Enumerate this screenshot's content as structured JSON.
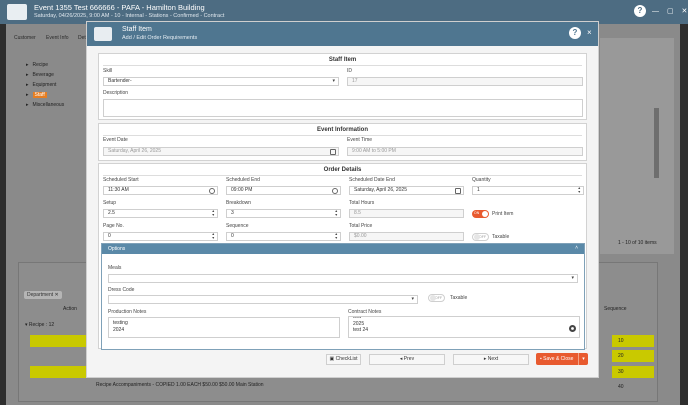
{
  "app": {
    "title": "Event 1355 Test 666666 - PAFA - Hamilton Building",
    "subtitle": "Saturday, 04/26/2025, 9:00 AM - 10 - Internal - Stations - Confirmed - Contract",
    "help": "?",
    "header_icons": "— ▢ ✕"
  },
  "background": {
    "tabs": [
      "Customer",
      "Event Info",
      "Det"
    ],
    "tree": [
      {
        "label": "Recipe",
        "highlight": false
      },
      {
        "label": "Beverage",
        "highlight": false
      },
      {
        "label": "Equipment",
        "highlight": false
      },
      {
        "label": "Staff",
        "highlight": true
      },
      {
        "label": "Miscellaneous",
        "highlight": false
      }
    ],
    "items_count": "1 - 10 of 10 items",
    "chip": "Department ✕",
    "action_header": "Action",
    "recipe_group": "▾ Recipe : 12",
    "sequence_header": "Sequence",
    "row_values": [
      "10",
      "20",
      "30",
      "40"
    ],
    "last_row": "Recipe     Accompaniments - COPIED          1.00    EACH    $50.00    $50.00            Main Station"
  },
  "modal": {
    "title": "Staff Item",
    "subtitle": "Add / Edit Order Requirements",
    "help": "?",
    "close": "×",
    "staff_item": {
      "section_title": "Staff Item",
      "skill_label": "Skill",
      "skill_value": "Bartender-",
      "id_label": "ID",
      "id_value": "17",
      "description_label": "Description",
      "description_value": ""
    },
    "event_info": {
      "section_title": "Event Information",
      "event_date_label": "Event Date",
      "event_date_value": "Saturday, April 26, 2025",
      "event_time_label": "Event Time",
      "event_time_value": "9:00 AM to 5:00 PM"
    },
    "order_details": {
      "section_title": "Order Details",
      "scheduled_start_label": "Scheduled Start",
      "scheduled_start_value": "11:30 AM",
      "scheduled_end_label": "Scheduled End",
      "scheduled_end_value": "09:00 PM",
      "scheduled_date_end_label": "Scheduled Date End",
      "scheduled_date_end_value": "Saturday, April 26, 2025",
      "quantity_label": "Quantity",
      "quantity_value": "1",
      "setup_label": "Setup",
      "setup_value": "2.5",
      "breakdown_label": "Breakdown",
      "breakdown_value": "3",
      "total_hours_label": "Total Hours",
      "total_hours_value": "8.5",
      "print_item_label": "Print Item",
      "print_item_toggle": "ON",
      "page_no_label": "Page No.",
      "page_no_value": "0",
      "sequence_label": "Sequence",
      "sequence_value": "0",
      "total_price_label": "Total Price",
      "total_price_value": "$0.00",
      "taxable_label": "Taxable",
      "taxable_toggle": "OFF"
    },
    "options": {
      "title": "Options",
      "chevron": "˄",
      "meals_label": "Meals",
      "meals_value": "",
      "dress_code_label": "Dress Code",
      "dress_code_value": "",
      "dress_taxable_label": "Taxable",
      "dress_taxable_toggle": "OFF",
      "production_notes_label": "Production Notes",
      "production_notes_lines": [
        "testing",
        "2024"
      ],
      "contract_notes_label": "Contract Notes",
      "contract_notes_lines": [
        "test",
        "2025",
        "test 24"
      ]
    },
    "footer": {
      "checklist": "CheckList",
      "prev": "◂ Prev",
      "next": "▸ Next",
      "save_close": "Save & Close",
      "save_caret": "▾"
    }
  },
  "colors": {
    "header": "#4f7690",
    "accent": "#e85a2f",
    "highlight_row": "#c9c900"
  }
}
